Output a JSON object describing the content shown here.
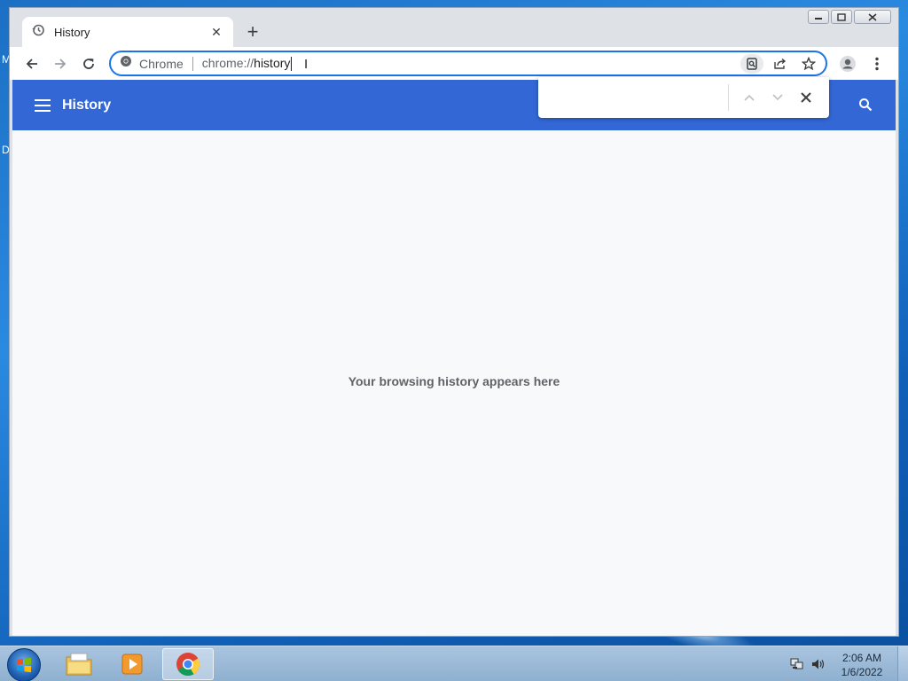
{
  "desktop": {
    "edge_labels": [
      "M",
      "D"
    ]
  },
  "browser": {
    "tab": {
      "title": "History"
    },
    "omnibox": {
      "chip": "Chrome",
      "url_scheme": "chrome://",
      "url_host": "history"
    }
  },
  "page": {
    "title": "History",
    "empty_message": "Your browsing history appears here"
  },
  "find_bar": {
    "value": ""
  },
  "taskbar": {
    "clock_time": "2:06 AM",
    "clock_date": "1/6/2022"
  },
  "colors": {
    "header_blue": "#3367d6",
    "focus_ring": "#1a73e8",
    "page_bg": "#f8f9fa"
  }
}
